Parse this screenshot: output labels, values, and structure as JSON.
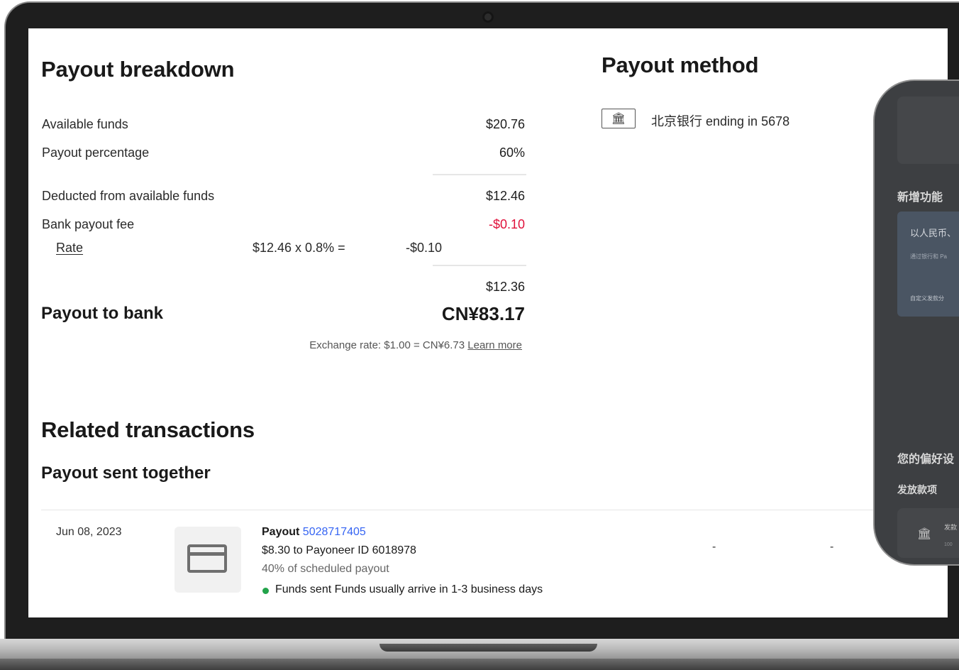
{
  "breakdown": {
    "title": "Payout breakdown",
    "available_funds": {
      "label": "Available funds",
      "value": "$20.76"
    },
    "payout_percentage": {
      "label": "Payout percentage",
      "value": "60%"
    },
    "deducted": {
      "label": "Deducted from available funds",
      "value": "$12.46"
    },
    "bank_fee": {
      "label": "Bank payout fee",
      "value": "-$0.10"
    },
    "rate": {
      "label": "Rate",
      "formula": "$12.46  x  0.8% =",
      "result": "-$0.10"
    },
    "subtotal": "$12.36",
    "payout_to_bank": {
      "label": "Payout to bank",
      "value": "CN¥83.17"
    },
    "exchange_rate": {
      "text": "Exchange rate: $1.00 = CN¥6.73",
      "link": "Learn more"
    }
  },
  "method": {
    "title": "Payout method",
    "bank_icon": "bank-icon",
    "bank_glyph": "🏛",
    "account": "北京银行 ending in 5678"
  },
  "related": {
    "title": "Related transactions",
    "subtitle": "Payout sent together",
    "row": {
      "date": "Jun 08, 2023",
      "icon": "credit-card-icon",
      "payout_label": "Payout",
      "payout_id": "5028717405",
      "amount_line": "$8.30 to Payoneer ID 6018978",
      "percent_line": "40% of scheduled payout",
      "status": "Funds sent",
      "status_note": "Funds usually arrive in 1-3 business days",
      "status_color": "#22a34a",
      "col_a": "-",
      "col_b": "-"
    }
  },
  "phone": {
    "new_features": "新增功能",
    "card_title": "以人民币、",
    "card_sub": "通过银行和 Pa",
    "card_footer": "自定义发款分",
    "preferences": "您的偏好设",
    "payouts": "发放款项",
    "item_icon": "bank-icon",
    "item_glyph": "🏛",
    "item_title": "发款",
    "item_sub": "100"
  }
}
